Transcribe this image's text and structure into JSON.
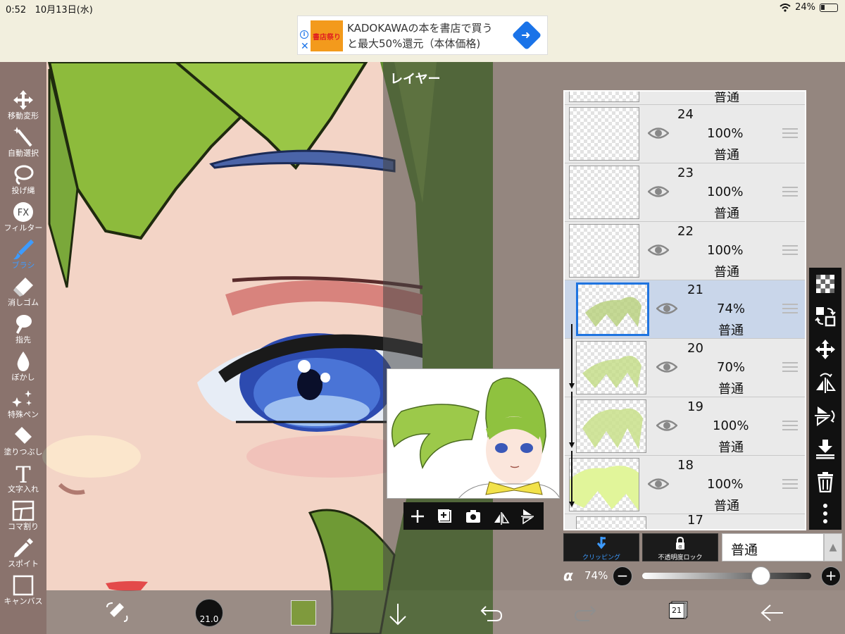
{
  "status": {
    "time": "0:52",
    "date": "10月13日(水)",
    "battery": "24%"
  },
  "ad": {
    "image_text": "書店祭り",
    "line1": "KADOKAWAの本を書店で買う",
    "line2": "と最大50%還元（本体価格)"
  },
  "tools": [
    {
      "label": "移動変形",
      "icon": "move-icon"
    },
    {
      "label": "自動選択",
      "icon": "magic-wand-icon"
    },
    {
      "label": "投げ縄",
      "icon": "lasso-icon"
    },
    {
      "label": "フィルター",
      "icon": "fx-icon",
      "icon_text": "FX"
    },
    {
      "label": "ブラシ",
      "icon": "brush-icon",
      "active": true
    },
    {
      "label": "消しゴム",
      "icon": "eraser-icon"
    },
    {
      "label": "指先",
      "icon": "finger-icon"
    },
    {
      "label": "ぼかし",
      "icon": "blur-icon"
    },
    {
      "label": "特殊ペン",
      "icon": "special-pen-icon"
    },
    {
      "label": "塗りつぶし",
      "icon": "bucket-icon"
    },
    {
      "label": "文字入れ",
      "icon": "text-icon",
      "icon_text": "T"
    },
    {
      "label": "コマ割り",
      "icon": "frame-divider-icon"
    },
    {
      "label": "スポイト",
      "icon": "eyedropper-icon"
    },
    {
      "label": "キャンバス",
      "icon": "canvas-icon"
    }
  ],
  "layer_panel": {
    "title": "レイヤー",
    "top_partial_mode": "普通",
    "layers": [
      {
        "number": "24",
        "opacity": "100%",
        "mode": "普通",
        "selected": false,
        "clipped": false
      },
      {
        "number": "23",
        "opacity": "100%",
        "mode": "普通",
        "selected": false,
        "clipped": false
      },
      {
        "number": "22",
        "opacity": "100%",
        "mode": "普通",
        "selected": false,
        "clipped": false
      },
      {
        "number": "21",
        "opacity": "74%",
        "mode": "普通",
        "selected": true,
        "clipped": false
      },
      {
        "number": "20",
        "opacity": "70%",
        "mode": "普通",
        "selected": false,
        "clipped": true
      },
      {
        "number": "19",
        "opacity": "100%",
        "mode": "普通",
        "selected": false,
        "clipped": true
      },
      {
        "number": "18",
        "opacity": "100%",
        "mode": "普通",
        "selected": false,
        "clipped": false
      }
    ],
    "bottom_partial_number": "17",
    "clipping_label": "クリッピング",
    "alpha_lock_label": "不透明度ロック",
    "blend_mode": "普通",
    "alpha_symbol": "α",
    "alpha_value": "74%",
    "alpha_fraction": 0.74
  },
  "right_tools": [
    "transparency-icon",
    "layer-swap-icon",
    "move-layer-icon",
    "flip-horizontal-icon",
    "flip-vertical-icon",
    "merge-down-icon",
    "trash-icon",
    "more-icon"
  ],
  "bottom_bar": {
    "brush_size": "21.0",
    "current_color": "#7f9a3d",
    "layer_count": "21"
  },
  "colors": {
    "accent": "#3d9bff",
    "selection": "#1f74e0"
  }
}
